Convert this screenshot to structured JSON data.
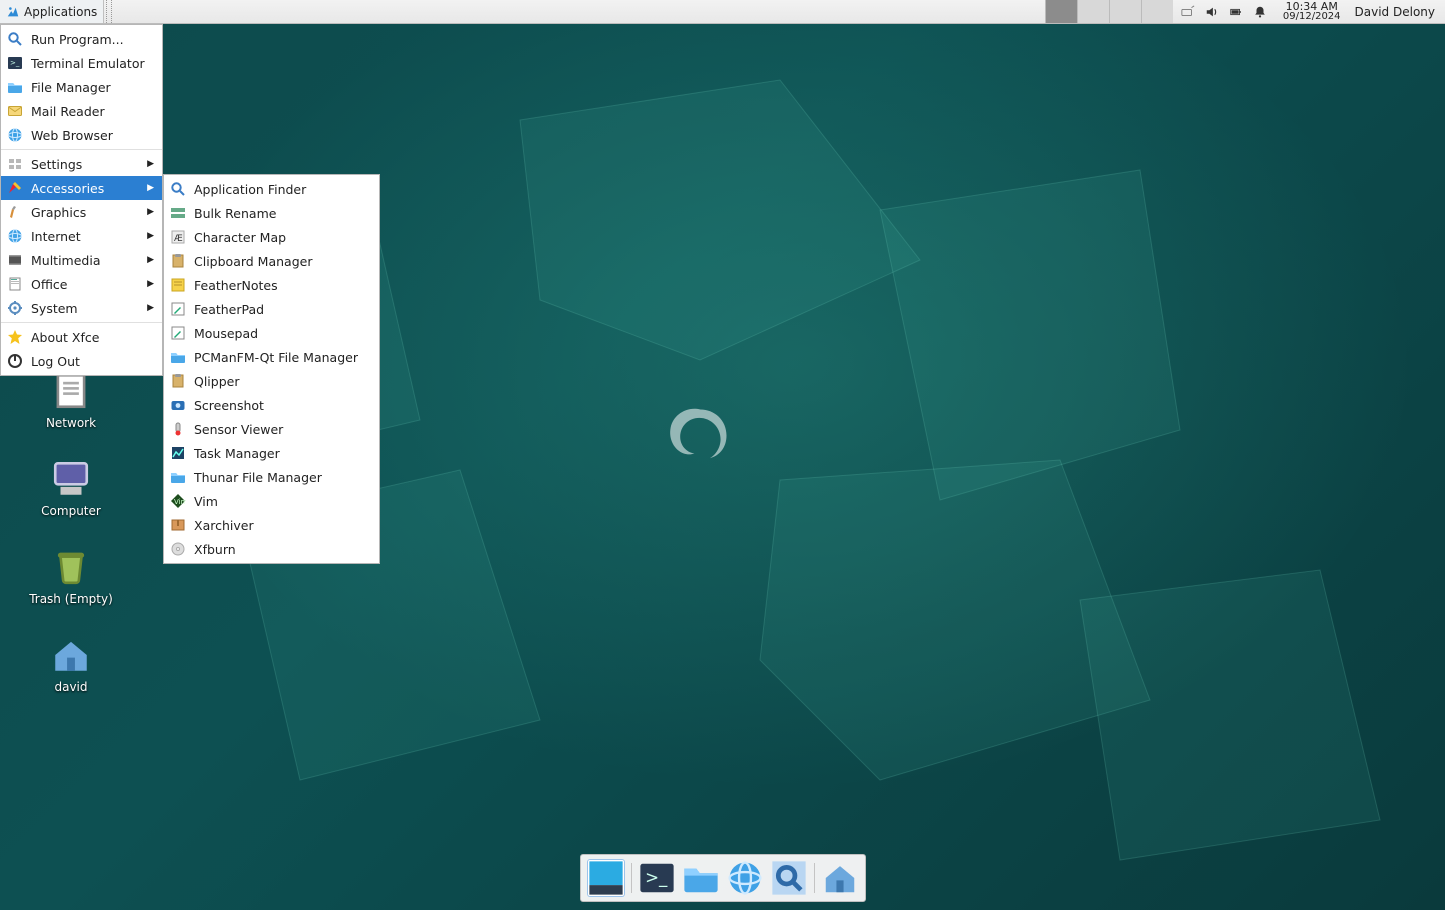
{
  "panel": {
    "applications_label": "Applications",
    "time": "10:34 AM",
    "date": "09/12/2024",
    "user": "David Delony",
    "workspaces": 4,
    "active_workspace": 0
  },
  "desktop_icons": [
    {
      "name": "network",
      "label": "Network"
    },
    {
      "name": "computer",
      "label": "Computer"
    },
    {
      "name": "trash",
      "label": "Trash (Empty)"
    },
    {
      "name": "home",
      "label": "david"
    }
  ],
  "menu": {
    "items": [
      {
        "icon": "search-icon",
        "label": "Run Program...",
        "has_submenu": false
      },
      {
        "icon": "terminal-icon",
        "label": "Terminal Emulator",
        "has_submenu": false
      },
      {
        "icon": "folder-icon",
        "label": "File Manager",
        "has_submenu": false
      },
      {
        "icon": "mail-icon",
        "label": "Mail Reader",
        "has_submenu": false
      },
      {
        "icon": "globe-icon",
        "label": "Web Browser",
        "has_submenu": false
      },
      {
        "sep": true
      },
      {
        "icon": "settings-icon",
        "label": "Settings",
        "has_submenu": true
      },
      {
        "icon": "accessories-icon",
        "label": "Accessories",
        "has_submenu": true,
        "highlight": true
      },
      {
        "icon": "graphics-icon",
        "label": "Graphics",
        "has_submenu": true
      },
      {
        "icon": "internet-icon",
        "label": "Internet",
        "has_submenu": true
      },
      {
        "icon": "multimedia-icon",
        "label": "Multimedia",
        "has_submenu": true
      },
      {
        "icon": "office-icon",
        "label": "Office",
        "has_submenu": true
      },
      {
        "icon": "system-icon",
        "label": "System",
        "has_submenu": true
      },
      {
        "sep": true
      },
      {
        "icon": "star-icon",
        "label": "About Xfce",
        "has_submenu": false
      },
      {
        "icon": "logout-icon",
        "label": "Log Out",
        "has_submenu": false
      }
    ]
  },
  "submenu": {
    "items": [
      {
        "icon": "search-icon",
        "label": "Application Finder"
      },
      {
        "icon": "rename-icon",
        "label": "Bulk Rename"
      },
      {
        "icon": "charmap-icon",
        "label": "Character Map"
      },
      {
        "icon": "clipboard-icon",
        "label": "Clipboard Manager"
      },
      {
        "icon": "notes-icon",
        "label": "FeatherNotes"
      },
      {
        "icon": "editor-icon",
        "label": "FeatherPad"
      },
      {
        "icon": "mousepad-icon",
        "label": "Mousepad"
      },
      {
        "icon": "pcmanfm-icon",
        "label": "PCManFM-Qt File Manager"
      },
      {
        "icon": "qlipper-icon",
        "label": "Qlipper"
      },
      {
        "icon": "screenshot-icon",
        "label": "Screenshot"
      },
      {
        "icon": "sensor-icon",
        "label": "Sensor Viewer"
      },
      {
        "icon": "taskmanager-icon",
        "label": "Task Manager"
      },
      {
        "icon": "thunar-icon",
        "label": "Thunar File Manager"
      },
      {
        "icon": "vim-icon",
        "label": "Vim"
      },
      {
        "icon": "archive-icon",
        "label": "Xarchiver"
      },
      {
        "icon": "xfburn-icon",
        "label": "Xfburn"
      }
    ]
  },
  "dock": {
    "items": [
      {
        "icon": "show-desktop-icon",
        "active": true
      },
      {
        "sep": true
      },
      {
        "icon": "terminal-icon"
      },
      {
        "icon": "folder-icon"
      },
      {
        "icon": "globe-icon"
      },
      {
        "icon": "appfinder-icon"
      },
      {
        "sep": true
      },
      {
        "icon": "home-folder-icon"
      }
    ]
  }
}
